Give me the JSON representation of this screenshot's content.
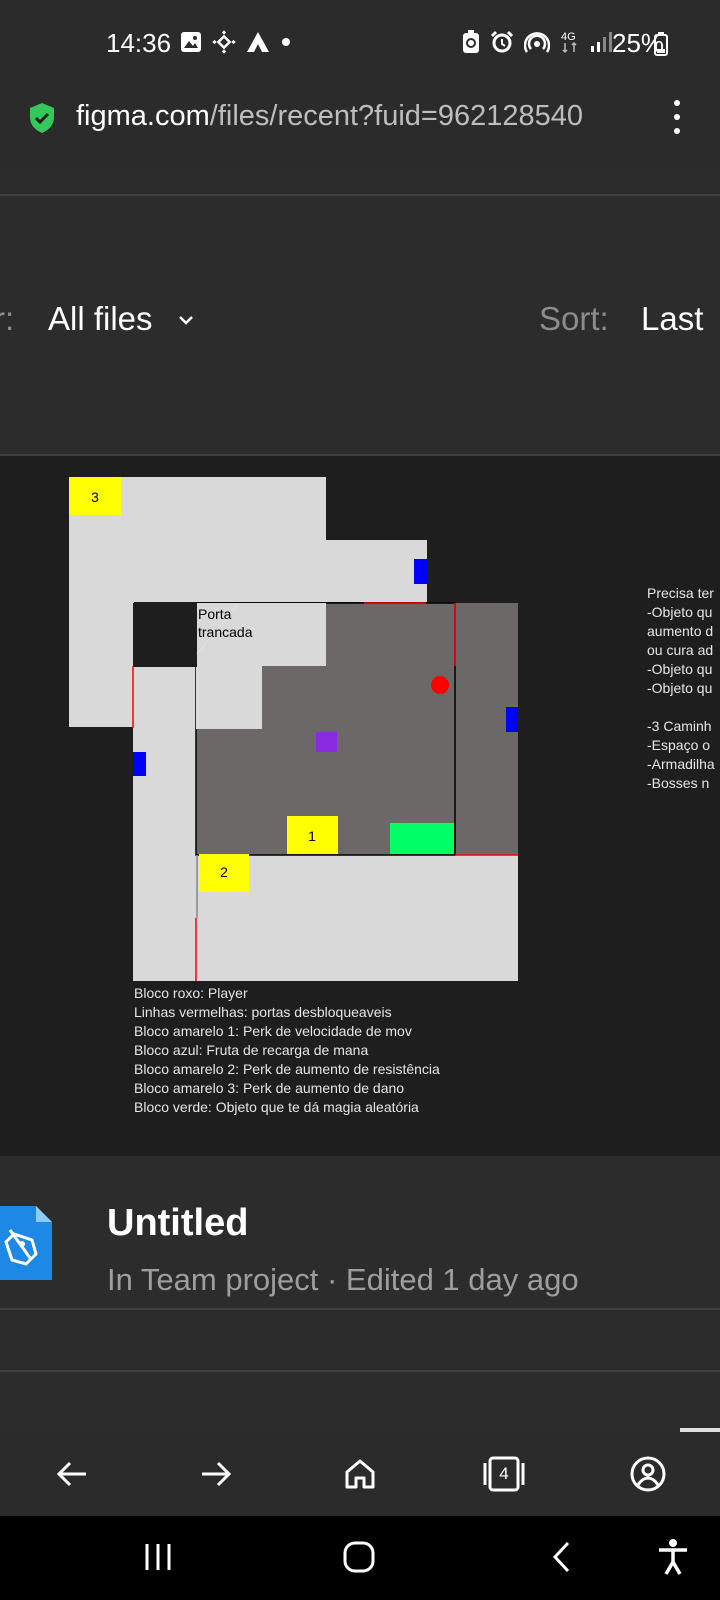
{
  "status_bar": {
    "time": "14:36",
    "battery": "25%",
    "left_icons": [
      "image-icon",
      "binance-icon",
      "arrow-up-icon",
      "dot-icon"
    ],
    "right_icons": [
      "vpn-icon",
      "alarm-icon",
      "hotspot-icon",
      "4g-icon",
      "signal-icon",
      "battery-icon"
    ],
    "network": "4G"
  },
  "url_bar": {
    "host": "figma.com",
    "path": "/files/recent?fuid=962128540"
  },
  "filter": {
    "label": "r:",
    "value": "All files",
    "sort_label": "Sort:",
    "sort_value": "Last"
  },
  "thumbnail": {
    "lock_label_1": "Porta",
    "lock_label_2": "trancada",
    "block_labels": [
      "3",
      "1",
      "2"
    ],
    "legend": [
      "Bloco roxo: Player",
      "Linhas vermelhas: portas desbloqueaveis",
      "Bloco amarelo 1: Perk de velocidade de mov",
      "Bloco azul: Fruta de recarga de mana",
      "Bloco amarelo 2: Perk de aumento de resistência",
      "Bloco amarelo 3: Perk de aumento de dano",
      "Bloco verde: Objeto que te dá magia aleatória"
    ],
    "notes": [
      "Precisa ter",
      "-Objeto qu",
      "aumento d",
      "ou cura ad",
      "-Objeto qu",
      "-Objeto qu",
      "",
      "-3 Caminh",
      "-Espaço o",
      "-Armadilha",
      "-Bosses n"
    ],
    "colors": {
      "yellow": "#ffff00",
      "blue": "#0000ff",
      "purple": "#8a2be2",
      "green": "#00ff66",
      "red": "#ff0000",
      "floor": "#d9d9d9",
      "room": "#6b6867"
    }
  },
  "file": {
    "name": "Untitled",
    "meta": "In Team project · Edited 1 day ago",
    "icon": "figma-pen-icon"
  },
  "browser_nav": {
    "tab_count": "4",
    "icons": [
      "back-arrow-icon",
      "forward-arrow-icon",
      "home-icon",
      "tabs-icon",
      "account-icon"
    ]
  },
  "system_nav": {
    "icons": [
      "recents-icon",
      "home-circle-icon",
      "back-chevron-icon",
      "accessibility-icon"
    ]
  }
}
